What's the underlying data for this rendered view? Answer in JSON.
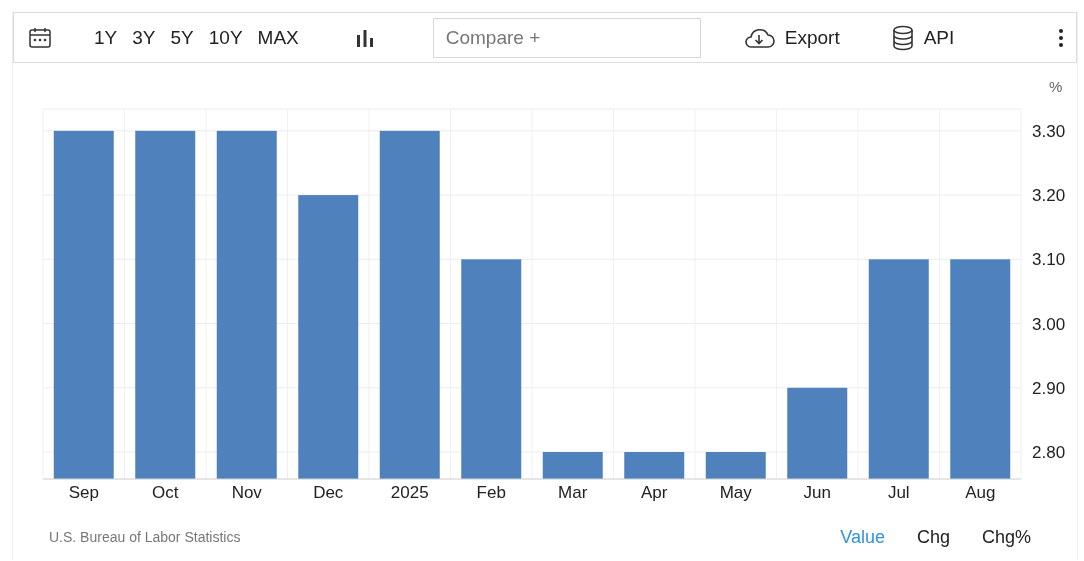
{
  "toolbar": {
    "ranges": [
      {
        "label": "1Y"
      },
      {
        "label": "3Y"
      },
      {
        "label": "5Y"
      },
      {
        "label": "10Y"
      },
      {
        "label": "MAX"
      }
    ],
    "compare": {
      "placeholder": "Compare +"
    },
    "export": "Export",
    "api": "API"
  },
  "chart": {
    "unit": "%",
    "chart_data": {
      "type": "bar",
      "categories": [
        "Sep",
        "Oct",
        "Nov",
        "Dec",
        "2025",
        "Feb",
        "Mar",
        "Apr",
        "May",
        "Jun",
        "Jul",
        "Aug"
      ],
      "grid": true,
      "series": [
        {
          "color": "#4f81bd",
          "values": [
            3.3,
            3.3,
            3.3,
            3.2,
            3.3,
            3.1,
            2.8,
            2.8,
            2.8,
            2.9,
            3.1,
            3.1
          ]
        }
      ],
      "ylim": [
        2.758,
        3.334
      ],
      "yticks": [
        {
          "value": 2.8,
          "label": "2.80"
        },
        {
          "value": 2.9,
          "label": "2.90"
        },
        {
          "value": 3.0,
          "label": "3.00"
        },
        {
          "value": 3.1,
          "label": "3.10"
        },
        {
          "value": 3.2,
          "label": "3.20"
        },
        {
          "value": 3.3,
          "label": "3.30"
        }
      ]
    }
  },
  "footer": {
    "source": "U.S. Bureau of Labor Statistics",
    "views": [
      {
        "label": "Value",
        "selected": true
      },
      {
        "label": "Chg",
        "selected": false
      },
      {
        "label": "Chg%",
        "selected": false
      }
    ]
  }
}
